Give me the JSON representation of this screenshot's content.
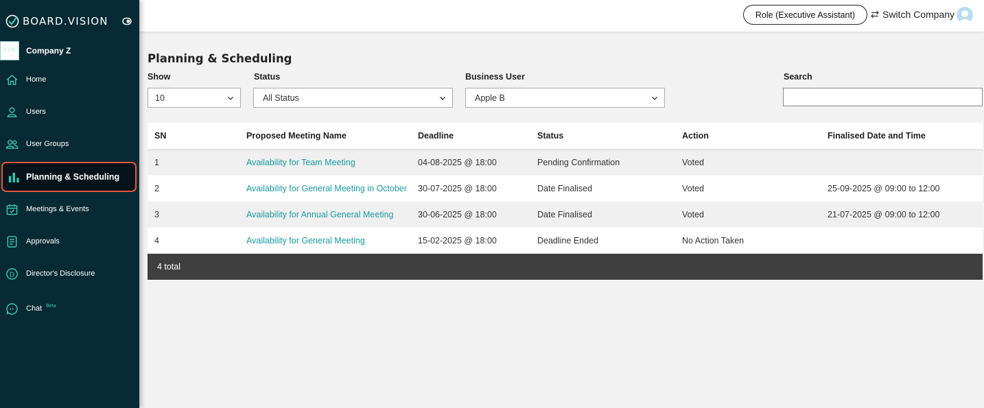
{
  "brand": {
    "name": "BOARD.VISION"
  },
  "company": {
    "name": "Company Z",
    "logo_text": "Z LTD"
  },
  "sidebar": {
    "items": [
      {
        "label": "Home",
        "icon": "home-icon"
      },
      {
        "label": "Users",
        "icon": "user-icon"
      },
      {
        "label": "User Groups",
        "icon": "user-group-icon"
      },
      {
        "label": "Planning & Scheduling",
        "icon": "bar-chart-icon",
        "active": true
      },
      {
        "label": "Meetings & Events",
        "icon": "calendar-icon"
      },
      {
        "label": "Approvals",
        "icon": "document-icon"
      },
      {
        "label": "Director's Disclosure",
        "icon": "circle-d-icon"
      },
      {
        "label": "Chat",
        "icon": "chat-icon",
        "badge": "Beta"
      }
    ]
  },
  "header": {
    "role_label": "Role (Executive Assistant)",
    "switch_label": "Switch Company"
  },
  "page": {
    "title": "Planning & Scheduling"
  },
  "filters": {
    "show": {
      "label": "Show",
      "value": "10"
    },
    "status": {
      "label": "Status",
      "value": "All Status"
    },
    "business_user": {
      "label": "Business User",
      "value": "Apple B"
    },
    "search": {
      "label": "Search",
      "value": "",
      "placeholder": ""
    }
  },
  "table": {
    "headers": [
      "SN",
      "Proposed Meeting Name",
      "Deadline",
      "Status",
      "Action",
      "Finalised Date and Time"
    ],
    "rows": [
      {
        "sn": "1",
        "name": "Availability for Team Meeting",
        "deadline": "04-08-2025 @ 18:00",
        "status": "Pending Confirmation",
        "action": "Voted",
        "finalised": ""
      },
      {
        "sn": "2",
        "name": "Availability for General Meeting in October",
        "deadline": "30-07-2025 @ 18:00",
        "status": "Date Finalised",
        "action": "Voted",
        "finalised": "25-09-2025 @ 09:00 to 12:00"
      },
      {
        "sn": "3",
        "name": "Availability for Annual General Meeting",
        "deadline": "30-06-2025 @ 18:00",
        "status": "Date Finalised",
        "action": "Voted",
        "finalised": "21-07-2025 @ 09:00 to 12:00"
      },
      {
        "sn": "4",
        "name": "Availability for General Meeting",
        "deadline": "15-02-2025 @ 18:00",
        "status": "Deadline Ended",
        "action": "No Action Taken",
        "finalised": ""
      }
    ],
    "total": "4 total"
  },
  "colors": {
    "sidebar_bg": "#082a34",
    "accent": "#1a9aa0",
    "active_outline": "#e8553e"
  }
}
